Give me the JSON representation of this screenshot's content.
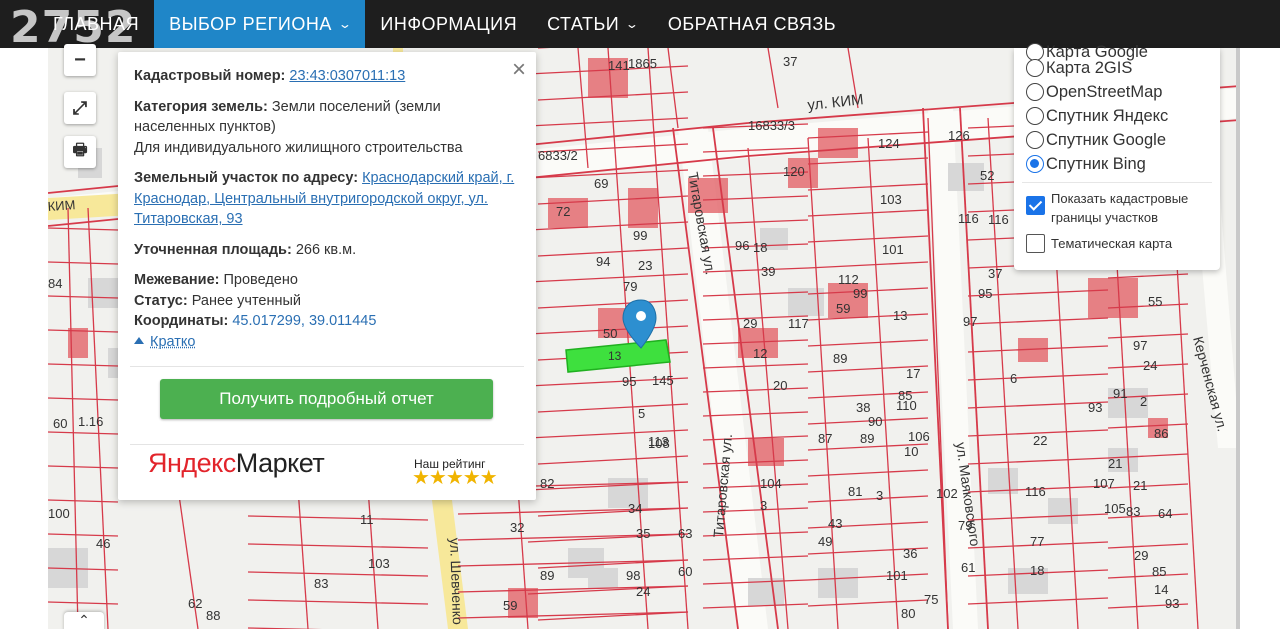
{
  "watermark": "2752",
  "nav": {
    "items": [
      {
        "label": "Главная",
        "dropdown": false,
        "active": false
      },
      {
        "label": "Выбор региона",
        "dropdown": true,
        "active": true
      },
      {
        "label": "Информация",
        "dropdown": false,
        "active": false
      },
      {
        "label": "Статьи",
        "dropdown": true,
        "active": false
      },
      {
        "label": "Обратная связь",
        "dropdown": false,
        "active": false
      }
    ],
    "chevron": "⌄",
    "active_color": "#1f86c8"
  },
  "map_controls": {
    "zoom_out": "−",
    "fullscreen_icon": "⤢",
    "print_icon": "🖶",
    "up_icon": "⌃"
  },
  "map_labels": {
    "streets": [
      "ул. КИМ",
      "КИМ",
      "Титаровская ул.",
      "ул. Маяковского",
      "Керченская ул.",
      "ул. Шевченко",
      "Титаровская ул."
    ],
    "numbers": [
      "141",
      "1865",
      "37",
      "16833/3",
      "126",
      "116",
      "6833/2",
      "69",
      "120",
      "124",
      "52",
      "14",
      "72",
      "99",
      "103",
      "116",
      "96",
      "18",
      "101",
      "37",
      "97",
      "94",
      "23",
      "39",
      "112",
      "99",
      "95",
      "17",
      "92",
      "55",
      "97",
      "79",
      "29",
      "117",
      "59",
      "13",
      "24",
      "50",
      "95",
      "145",
      "12",
      "89",
      "6",
      "83",
      "20",
      "110",
      "93",
      "5",
      "38",
      "2",
      "91",
      "108",
      "113",
      "87",
      "90",
      "85",
      "22",
      "89",
      "106",
      "116",
      "86",
      "21",
      "21",
      "104",
      "10",
      "107",
      "83",
      "81",
      "34",
      "3",
      "3",
      "102",
      "105",
      "64",
      "43",
      "79",
      "29",
      "32",
      "35",
      "63",
      "61",
      "77",
      "82",
      "11",
      "103",
      "60",
      "49",
      "36",
      "85",
      "98",
      "89",
      "24",
      "101",
      "18",
      "59",
      "14",
      "93",
      "83",
      "62",
      "88",
      "80",
      "75",
      "100",
      "46",
      "60",
      "1.16",
      "84"
    ],
    "selected_parcel": "13"
  },
  "popup": {
    "close": "×",
    "cadastral_label": "Кадастровый номер:",
    "cadastral_value": "23:43:0307011:13",
    "category_label": "Категория земель:",
    "category_value": "Земли поселений (земли населенных пунктов)",
    "usage": "Для индивидуального жилищного строительства",
    "address_label": "Земельный участок по адресу:",
    "address_value": "Краснодарский край, г. Краснодар, Центральный внутригородской округ, ул. Титаровская, 93",
    "area_label": "Уточненная площадь:",
    "area_value": "266 кв.м.",
    "survey_label": "Межевание:",
    "survey_value": "Проведено",
    "status_label": "Статус:",
    "status_value": "Ранее учтенный",
    "coords_label": "Координаты:",
    "coords_value": "45.017299, 39.011445",
    "short_link": "Кратко",
    "report_button": "Получить подробный отчет",
    "market_logo_y": "Яндекс",
    "market_logo_rest": "Маркет",
    "rating_label": "Наш рейтинг",
    "rating_value": 5,
    "stars": "★★★★★"
  },
  "layers": {
    "options": [
      {
        "label": "Карта Google",
        "selected": false
      },
      {
        "label": "Карта 2GIS",
        "selected": false
      },
      {
        "label": "OpenStreetMap",
        "selected": false
      },
      {
        "label": "Спутник Яндекс",
        "selected": false
      },
      {
        "label": "Спутник Google",
        "selected": false
      },
      {
        "label": "Спутник Bing",
        "selected": true
      }
    ],
    "show_borders_label": "Показать кадастровые границы участков",
    "show_borders_checked": true,
    "thematic_label": "Тематическая карта",
    "thematic_checked": false
  },
  "colors": {
    "parcel_border": "#d63a4a",
    "parcel_fill": "#e25a60",
    "selected_fill": "#3ee03e",
    "marker": "#2d8fd0",
    "button_green": "#4cb050"
  }
}
